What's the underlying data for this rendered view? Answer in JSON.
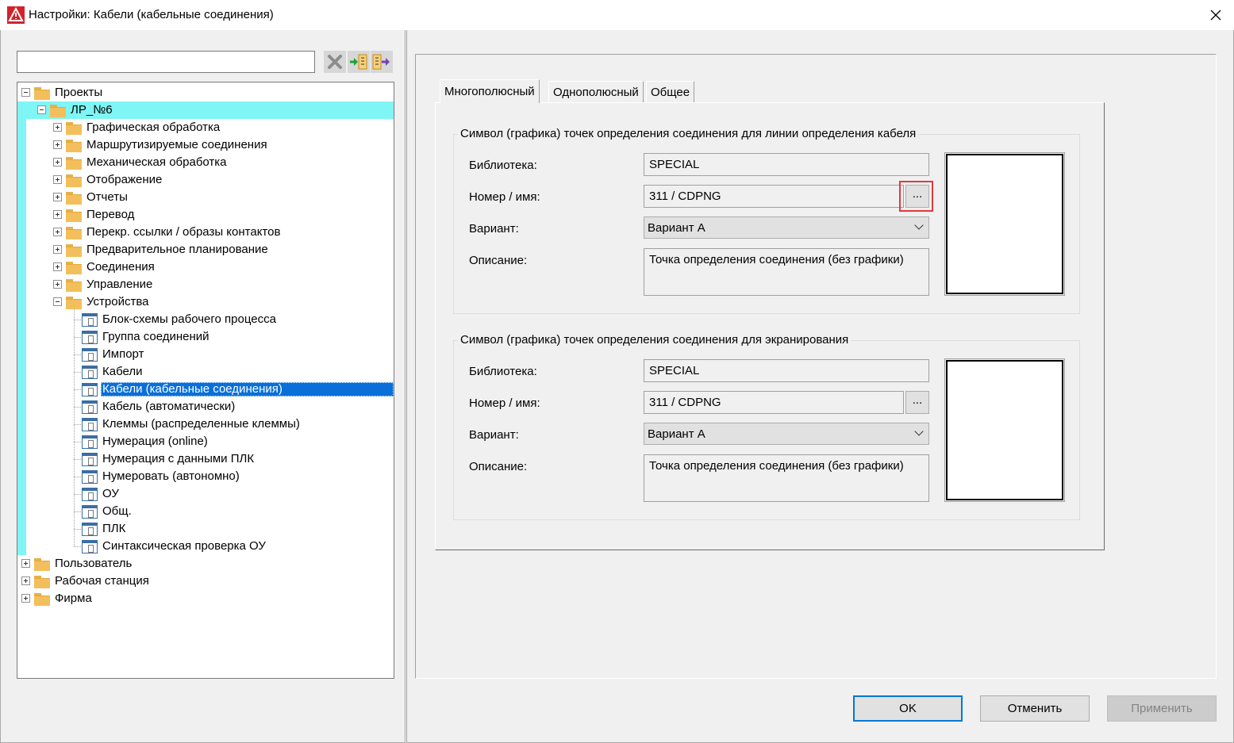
{
  "window": {
    "title": "Настройки: Кабели (кабельные соединения)",
    "app_icon": "eplan-logo-icon",
    "close_glyph": "✕"
  },
  "left": {
    "search": {
      "value": "",
      "placeholder": ""
    },
    "toolbar": [
      {
        "name": "clear-filter-icon"
      },
      {
        "name": "import-settings-icon"
      },
      {
        "name": "export-settings-icon"
      }
    ]
  },
  "tree": [
    {
      "label": "Проекты",
      "level": 0,
      "expander": "minus",
      "icon": "folder"
    },
    {
      "label": "ЛР_№6",
      "level": 1,
      "expander": "minus",
      "icon": "folder",
      "highlighted": true
    },
    {
      "label": "Графическая обработка",
      "level": 2,
      "expander": "plus",
      "icon": "folder"
    },
    {
      "label": "Маршрутизируемые соединения",
      "level": 2,
      "expander": "plus",
      "icon": "folder"
    },
    {
      "label": "Механическая обработка",
      "level": 2,
      "expander": "plus",
      "icon": "folder"
    },
    {
      "label": "Отображение",
      "level": 2,
      "expander": "plus",
      "icon": "folder"
    },
    {
      "label": "Отчеты",
      "level": 2,
      "expander": "plus",
      "icon": "folder"
    },
    {
      "label": "Перевод",
      "level": 2,
      "expander": "plus",
      "icon": "folder"
    },
    {
      "label": "Перекр. ссылки / образы контактов",
      "level": 2,
      "expander": "plus",
      "icon": "folder"
    },
    {
      "label": "Предварительное планирование",
      "level": 2,
      "expander": "plus",
      "icon": "folder"
    },
    {
      "label": "Соединения",
      "level": 2,
      "expander": "plus",
      "icon": "folder"
    },
    {
      "label": "Управление",
      "level": 2,
      "expander": "plus",
      "icon": "folder"
    },
    {
      "label": "Устройства",
      "level": 2,
      "expander": "minus",
      "icon": "folder"
    },
    {
      "label": "Блок-схемы рабочего процесса",
      "level": 3,
      "icon": "page"
    },
    {
      "label": "Группа соединений",
      "level": 3,
      "icon": "page"
    },
    {
      "label": "Импорт",
      "level": 3,
      "icon": "page"
    },
    {
      "label": "Кабели",
      "level": 3,
      "icon": "page"
    },
    {
      "label": "Кабели (кабельные соединения)",
      "level": 3,
      "icon": "page",
      "selected": true
    },
    {
      "label": "Кабель (автоматически)",
      "level": 3,
      "icon": "page"
    },
    {
      "label": "Клеммы (распределенные клеммы)",
      "level": 3,
      "icon": "page"
    },
    {
      "label": "Нумерация (online)",
      "level": 3,
      "icon": "page"
    },
    {
      "label": "Нумерация с данными ПЛК",
      "level": 3,
      "icon": "page"
    },
    {
      "label": "Нумеровать (автономно)",
      "level": 3,
      "icon": "page"
    },
    {
      "label": "ОУ",
      "level": 3,
      "icon": "page"
    },
    {
      "label": "Общ.",
      "level": 3,
      "icon": "page"
    },
    {
      "label": "ПЛК",
      "level": 3,
      "icon": "page"
    },
    {
      "label": "Синтаксическая проверка ОУ",
      "level": 3,
      "icon": "page"
    },
    {
      "label": "Пользователь",
      "level": 0,
      "expander": "plus",
      "icon": "folder"
    },
    {
      "label": "Рабочая станция",
      "level": 0,
      "expander": "plus",
      "icon": "folder"
    },
    {
      "label": "Фирма",
      "level": 0,
      "expander": "plus",
      "icon": "folder"
    }
  ],
  "tabs": [
    {
      "label": "Многополюсный",
      "active": true
    },
    {
      "label": "Однополюсный",
      "active": false
    },
    {
      "label": "Общее",
      "active": false
    }
  ],
  "groups": [
    {
      "title": "Символ (графика) точек определения соединения для линии определения кабеля",
      "library_label": "Библиотека:",
      "library_value": "SPECIAL",
      "number_label": "Номер / имя:",
      "number_value": "311 / CDPNG",
      "browse_label": "...",
      "variant_label": "Вариант:",
      "variant_value": "Вариант A",
      "description_label": "Описание:",
      "description_value": "Точка определения соединения (без графики)",
      "browse_highlighted": true
    },
    {
      "title": "Символ (графика) точек определения соединения для экранирования",
      "library_label": "Библиотека:",
      "library_value": "SPECIAL",
      "number_label": "Номер / имя:",
      "number_value": "311 / CDPNG",
      "browse_label": "...",
      "variant_label": "Вариант:",
      "variant_value": "Вариант A",
      "description_label": "Описание:",
      "description_value": "Точка определения соединения (без графики)",
      "browse_highlighted": false
    }
  ],
  "buttons": {
    "ok": "OK",
    "cancel": "Отменить",
    "apply": "Применить"
  },
  "colors": {
    "tree_highlight": "#7ff5f5",
    "tree_selection": "#0a6fd8",
    "annotation_red": "#e3383d"
  }
}
